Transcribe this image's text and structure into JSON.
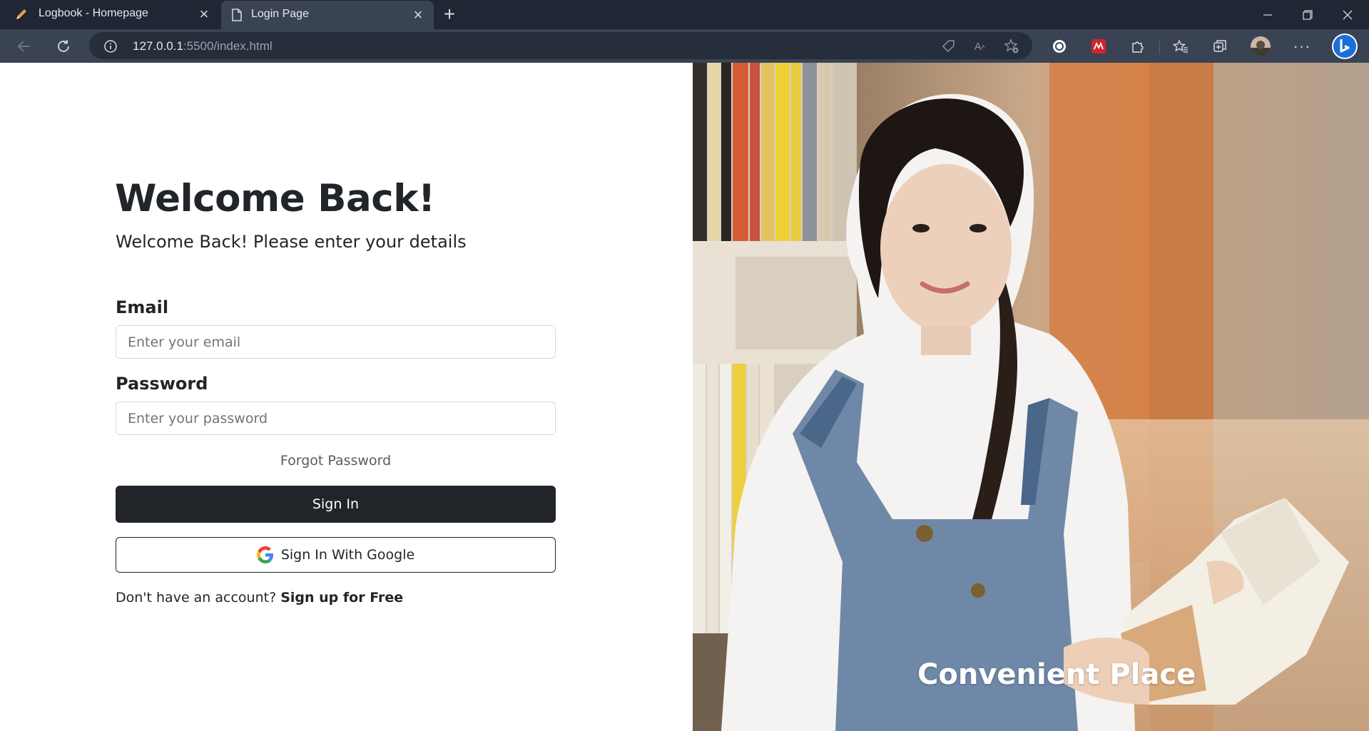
{
  "browser": {
    "tabs": [
      {
        "title": "Logbook - Homepage",
        "icon": "pencil-icon",
        "active": false
      },
      {
        "title": "Login Page",
        "icon": "page-icon",
        "active": true
      }
    ],
    "address": {
      "host": "127.0.0.1",
      "path": ":5500/index.html"
    }
  },
  "login": {
    "title": "Welcome Back!",
    "subtitle": "Welcome Back! Please enter your details",
    "email_label": "Email",
    "email_placeholder": "Enter your email",
    "password_label": "Password",
    "password_placeholder": "Enter your password",
    "forgot_password": "Forgot Password",
    "sign_in_label": "Sign In",
    "google_sign_in_label": "Sign In With Google",
    "no_account_text": "Don't have an account?",
    "signup_link": "Sign up for Free"
  },
  "hero": {
    "caption": "Convenient Place"
  },
  "colors": {
    "chrome_dark": "#202634",
    "chrome_toolbar": "#3a4353",
    "primary_button": "#212529",
    "text": "#212529"
  }
}
